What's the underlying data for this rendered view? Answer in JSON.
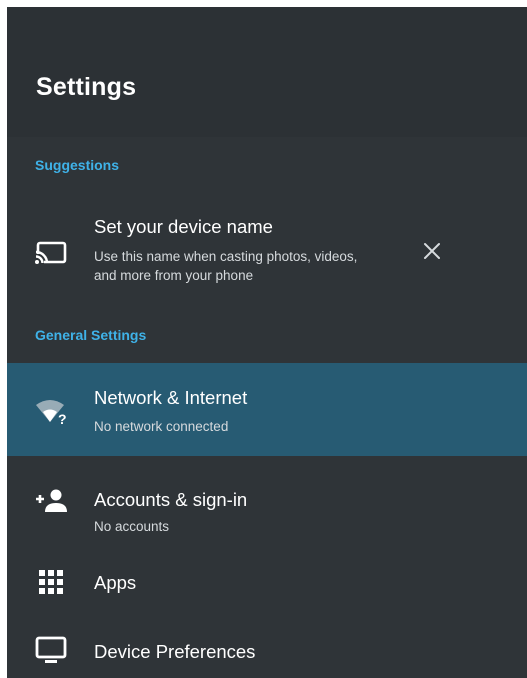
{
  "header": {
    "title": "Settings"
  },
  "suggestions": {
    "label": "Suggestions",
    "device_name": {
      "title": "Set your device name",
      "subtitle_line1": "Use this name when casting photos, videos,",
      "subtitle_line2": "and more from your phone",
      "icon": "cast-icon",
      "dismiss_icon": "close-icon"
    }
  },
  "general": {
    "label": "General Settings",
    "items": [
      {
        "title": "Network & Internet",
        "subtitle": "No network connected",
        "icon": "wifi-question-icon",
        "selected": true
      },
      {
        "title": "Accounts & sign-in",
        "subtitle": "No accounts",
        "icon": "add-person-icon"
      },
      {
        "title": "Apps",
        "icon": "apps-grid-icon"
      },
      {
        "title": "Device Preferences",
        "icon": "tv-icon"
      }
    ]
  },
  "colors": {
    "background": "#2f3438",
    "header": "#2c3135",
    "accent": "#3fb2e8",
    "selected_row": "#275b73"
  }
}
